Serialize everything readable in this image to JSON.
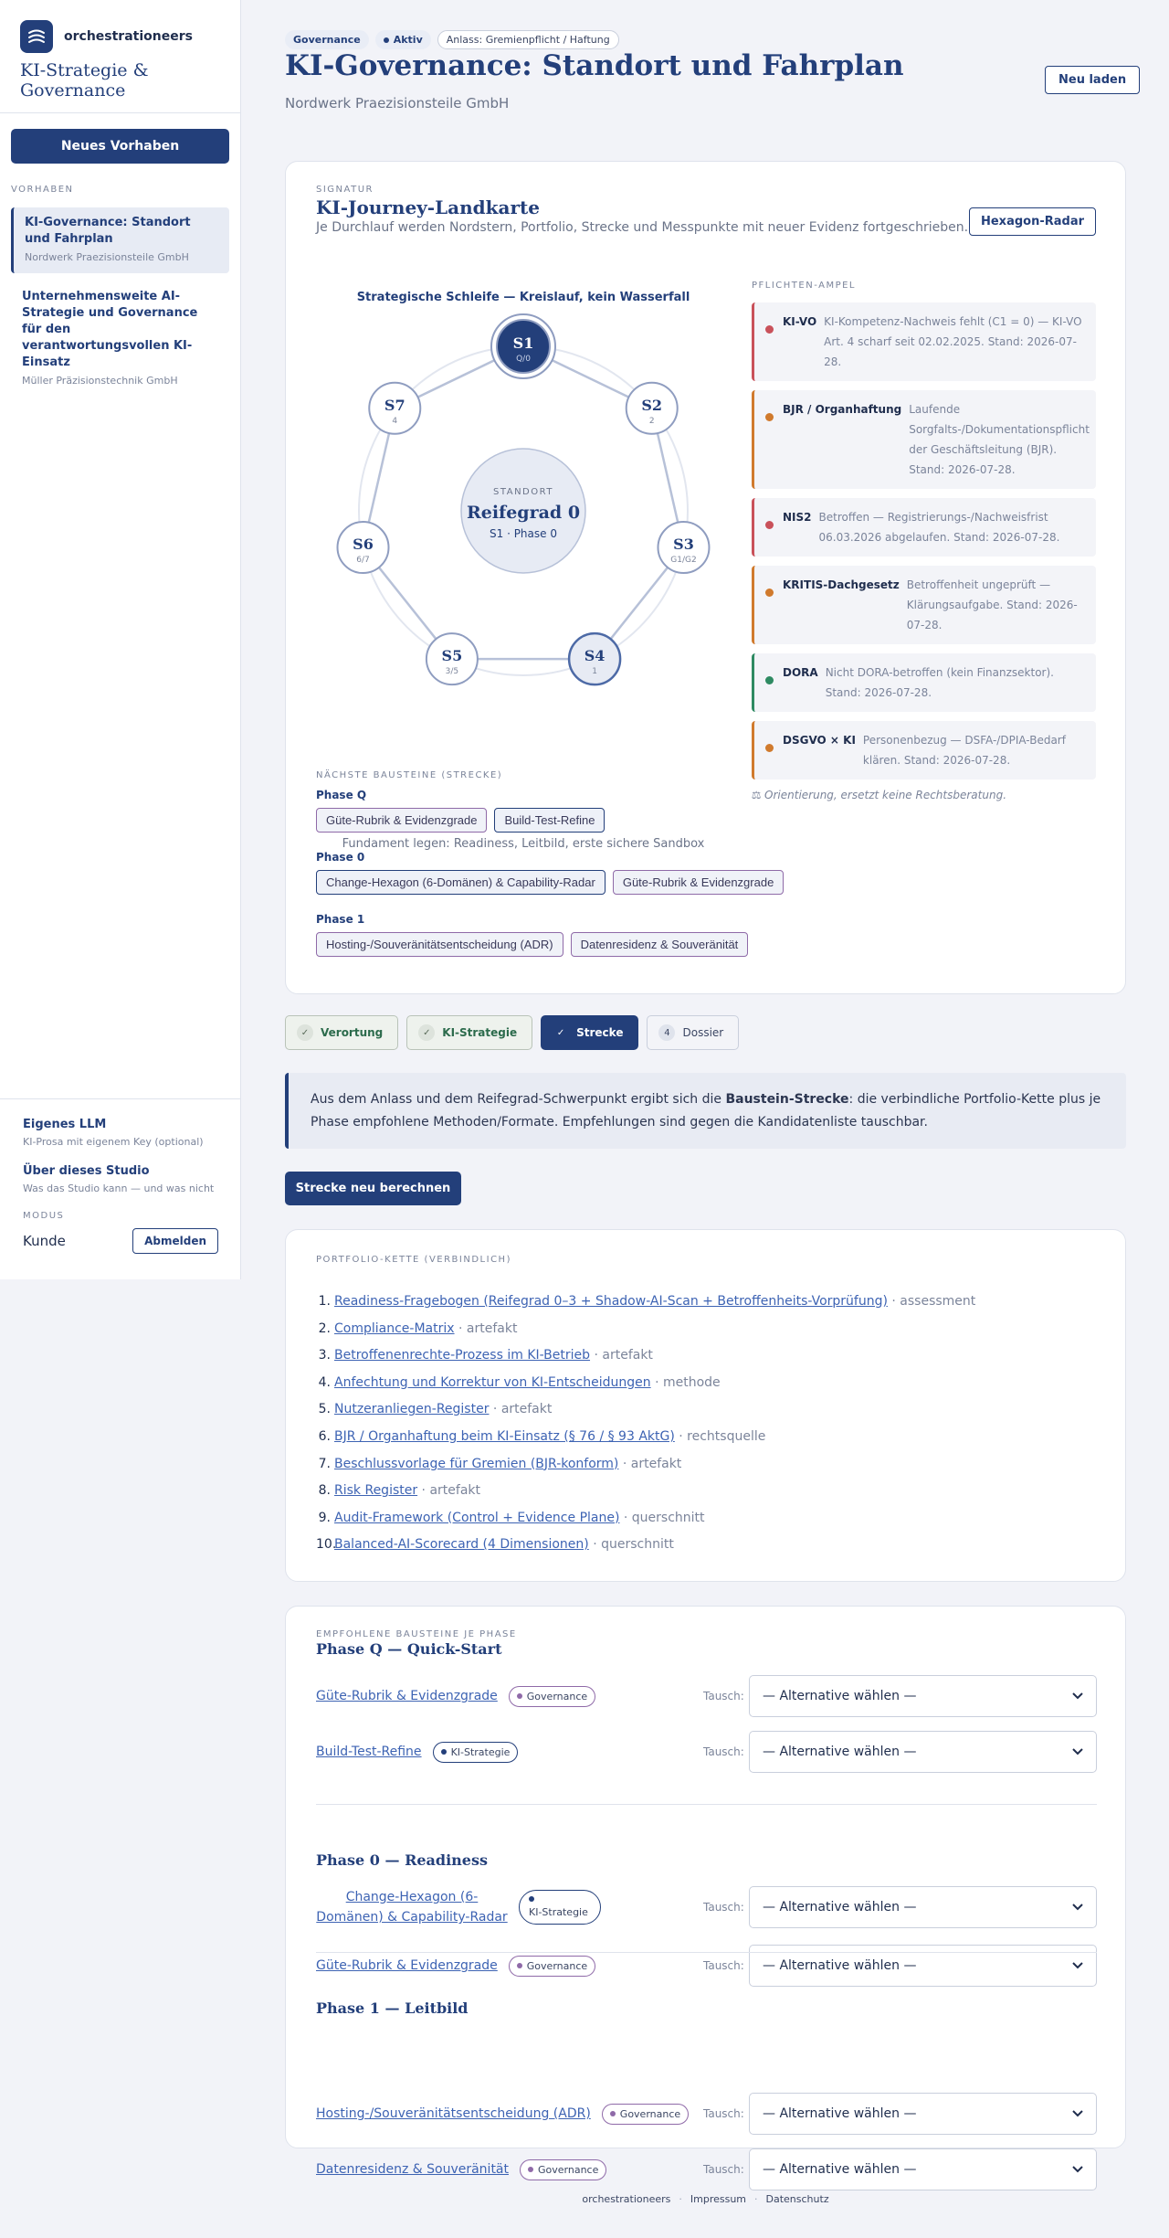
{
  "sidebar": {
    "brand_name": "orchestrationeers",
    "brand_sub": "KI-Strategie & Governance",
    "new_button": "Neues Vorhaben",
    "section_label": "VORHABEN",
    "projects": [
      {
        "title": "KI-Governance: Standort und Fahrplan",
        "sub": "Nordwerk Praezisionsteile GmbH"
      },
      {
        "title": "Unternehmensweite AI-Strategie und Governance für den verantwortungsvollen KI-Einsatz",
        "sub": "Müller Präzisionstechnik GmbH"
      }
    ],
    "links": [
      {
        "title": "Eigenes LLM",
        "sub": "KI-Prosa mit eigenem Key (optional)"
      },
      {
        "title": "Über dieses Studio",
        "sub": "Was das Studio kann — und was nicht"
      }
    ],
    "mode_label": "MODUS",
    "mode_value": "Kunde",
    "logout": "Abmelden"
  },
  "header": {
    "chips": [
      "Governance",
      "Aktiv",
      "Anlass: Gremienpflicht / Haftung"
    ],
    "title": "KI-Governance: Standort und Fahrplan",
    "subtitle": "Nordwerk Praezisionsteile GmbH",
    "reload": "Neu laden"
  },
  "journey": {
    "label": "SIGNATUR",
    "title": "KI-Journey-Landkarte",
    "desc": "Je Durchlauf werden Nordstern, Portfolio, Strecke und Messpunkte mit neuer Evidenz fortgeschrieben.",
    "hex_button": "Hexagon-Radar",
    "loop_title": "Strategische Schleife — Kreislauf, kein Wasserfall",
    "loop_caption": "Fundament legen: Readiness, Leitbild, erste sichere Sandbox",
    "center": {
      "label": "STANDORT",
      "title": "Reifegrad 0",
      "sub": "S1 · Phase 0"
    },
    "stations": [
      {
        "id": "S1",
        "sub": "Q/0",
        "state": "current"
      },
      {
        "id": "S2",
        "sub": "2",
        "state": "normal"
      },
      {
        "id": "S3",
        "sub": "G1/G2",
        "state": "normal"
      },
      {
        "id": "S4",
        "sub": "1",
        "state": "next"
      },
      {
        "id": "S5",
        "sub": "3/5",
        "state": "normal"
      },
      {
        "id": "S6",
        "sub": "6/7",
        "state": "normal"
      },
      {
        "id": "S7",
        "sub": "4",
        "state": "normal"
      }
    ],
    "ampel_label": "PFLICHTEN-AMPEL",
    "ampel": [
      {
        "key": "KI-VO",
        "text": "KI-Kompetenz-Nachweis fehlt (C1 = 0) — KI-VO Art. 4 scharf seit 02.02.2025. Stand: 2026-07-28.",
        "color": "#c9515a"
      },
      {
        "key": "BJR / Organhaftung",
        "text": "Laufende Sorgfalts-/Dokumentationspflicht der Geschäftsleitung (BJR). Stand: 2026-07-28.",
        "color": "#d07a2d"
      },
      {
        "key": "NIS2",
        "text": "Betroffen — Registrierungs-/Nachweisfrist 06.03.2026 abgelaufen. Stand: 2026-07-28.",
        "color": "#c9515a"
      },
      {
        "key": "KRITIS-Dachgesetz",
        "text": "Betroffenheit ungeprüft — Klärungsaufgabe. Stand: 2026-07-28.",
        "color": "#d07a2d"
      },
      {
        "key": "DORA",
        "text": "Nicht DORA-betroffen (kein Finanzsektor). Stand: 2026-07-28.",
        "color": "#2e8a62"
      },
      {
        "key": "DSGVO × KI",
        "text": "Personenbezug — DSFA-/DPIA-Bedarf klären. Stand: 2026-07-28.",
        "color": "#d07a2d"
      }
    ],
    "ampel_note": "⚖ Orientierung, ersetzt keine Rechtsberatung.",
    "next_label": "NÄCHSTE BAUSTEINE (STRECKE)",
    "next_phases": [
      {
        "name": "Phase Q",
        "items": [
          {
            "label": "Güte-Rubrik & Evidenzgrade",
            "kind": "gov"
          },
          {
            "label": "Build-Test-Refine",
            "kind": "strat"
          }
        ]
      },
      {
        "name": "Phase 0",
        "items": [
          {
            "label": "Change-Hexagon (6-Domänen) & Capability-Radar",
            "kind": "strat"
          },
          {
            "label": "Güte-Rubrik & Evidenzgrade",
            "kind": "gov"
          }
        ]
      },
      {
        "name": "Phase 1",
        "items": [
          {
            "label": "Hosting-/Souveränitätsentscheidung (ADR)",
            "kind": "gov"
          },
          {
            "label": "Datenresidenz & Souveränität",
            "kind": "gov"
          }
        ]
      }
    ]
  },
  "tabs": [
    {
      "label": "Verortung",
      "mark": "✓",
      "state": "done"
    },
    {
      "label": "KI-Strategie",
      "mark": "✓",
      "state": "done"
    },
    {
      "label": "Strecke",
      "mark": "✓",
      "state": "active"
    },
    {
      "label": "Dossier",
      "mark": "4",
      "state": "plain"
    }
  ],
  "info": {
    "pre": "Aus dem Anlass und dem Reifegrad-Schwerpunkt ergibt sich die ",
    "bold": "Baustein-Strecke",
    "post": ": die verbindliche Portfolio-Kette plus je Phase empfohlene Methoden/Formate. Empfehlungen sind gegen die Kandidatenliste tauschbar."
  },
  "recalc_button": "Strecke neu berechnen",
  "portfolio": {
    "label": "PORTFOLIO-KETTE (VERBINDLICH)",
    "items": [
      {
        "name": "Readiness-Fragebogen (Reifegrad 0–3 + Shadow-AI-Scan + Betroffenheits-Vorprüfung)",
        "type": " · assessment"
      },
      {
        "name": "Compliance-Matrix",
        "type": " · artefakt"
      },
      {
        "name": "Betroffenenrechte-Prozess im KI-Betrieb",
        "type": " · artefakt"
      },
      {
        "name": "Anfechtung und Korrektur von KI-Entscheidungen",
        "type": " · methode"
      },
      {
        "name": "Nutzeranliegen-Register",
        "type": " · artefakt"
      },
      {
        "name": "BJR / Organhaftung beim KI-Einsatz (§ 76 / § 93 AktG)",
        "type": " · rechtsquelle"
      },
      {
        "name": "Beschlussvorlage für Gremien (BJR-konform)",
        "type": " · artefakt"
      },
      {
        "name": "Risk Register",
        "type": " · artefakt"
      },
      {
        "name": "Audit-Framework (Control + Evidence Plane)",
        "type": " · querschnitt"
      },
      {
        "name": "Balanced-AI-Scorecard (4 Dimensionen)",
        "type": " · querschnitt"
      }
    ]
  },
  "recommended": {
    "label": "EMPFOHLENE BAUSTEINE JE PHASE",
    "tausch": "Tausch:",
    "select_placeholder": "— Alternative wählen —",
    "phases": [
      {
        "title": "Phase Q — Quick-Start",
        "items": [
          {
            "name": "Güte-Rubrik & Evidenzgrade",
            "badge": "Governance",
            "kind": "gov"
          },
          {
            "name": "Build-Test-Refine",
            "badge": "KI-Strategie",
            "kind": "strat"
          }
        ]
      },
      {
        "title": "Phase 0 — Readiness",
        "items": [
          {
            "name": "Change-Hexagon (6-Domänen) & Capability-Radar",
            "badge": "KI-Strategie",
            "kind": "strat"
          },
          {
            "name": "Güte-Rubrik & Evidenzgrade",
            "badge": "Governance",
            "kind": "gov"
          }
        ]
      },
      {
        "title": "Phase 1 — Leitbild",
        "items": [
          {
            "name": "Hosting-/Souveränitätsentscheidung (ADR)",
            "badge": "Governance",
            "kind": "gov"
          },
          {
            "name": "Datenresidenz & Souveränität",
            "badge": "Governance",
            "kind": "gov"
          }
        ]
      }
    ]
  },
  "footer": [
    "orchestrationeers",
    "Impressum",
    "Datenschutz"
  ],
  "colors": {
    "primary": "#233f7a",
    "gov": "#8f6aa8",
    "red": "#c9515a",
    "orange": "#d07a2d",
    "green": "#2e8a62"
  }
}
